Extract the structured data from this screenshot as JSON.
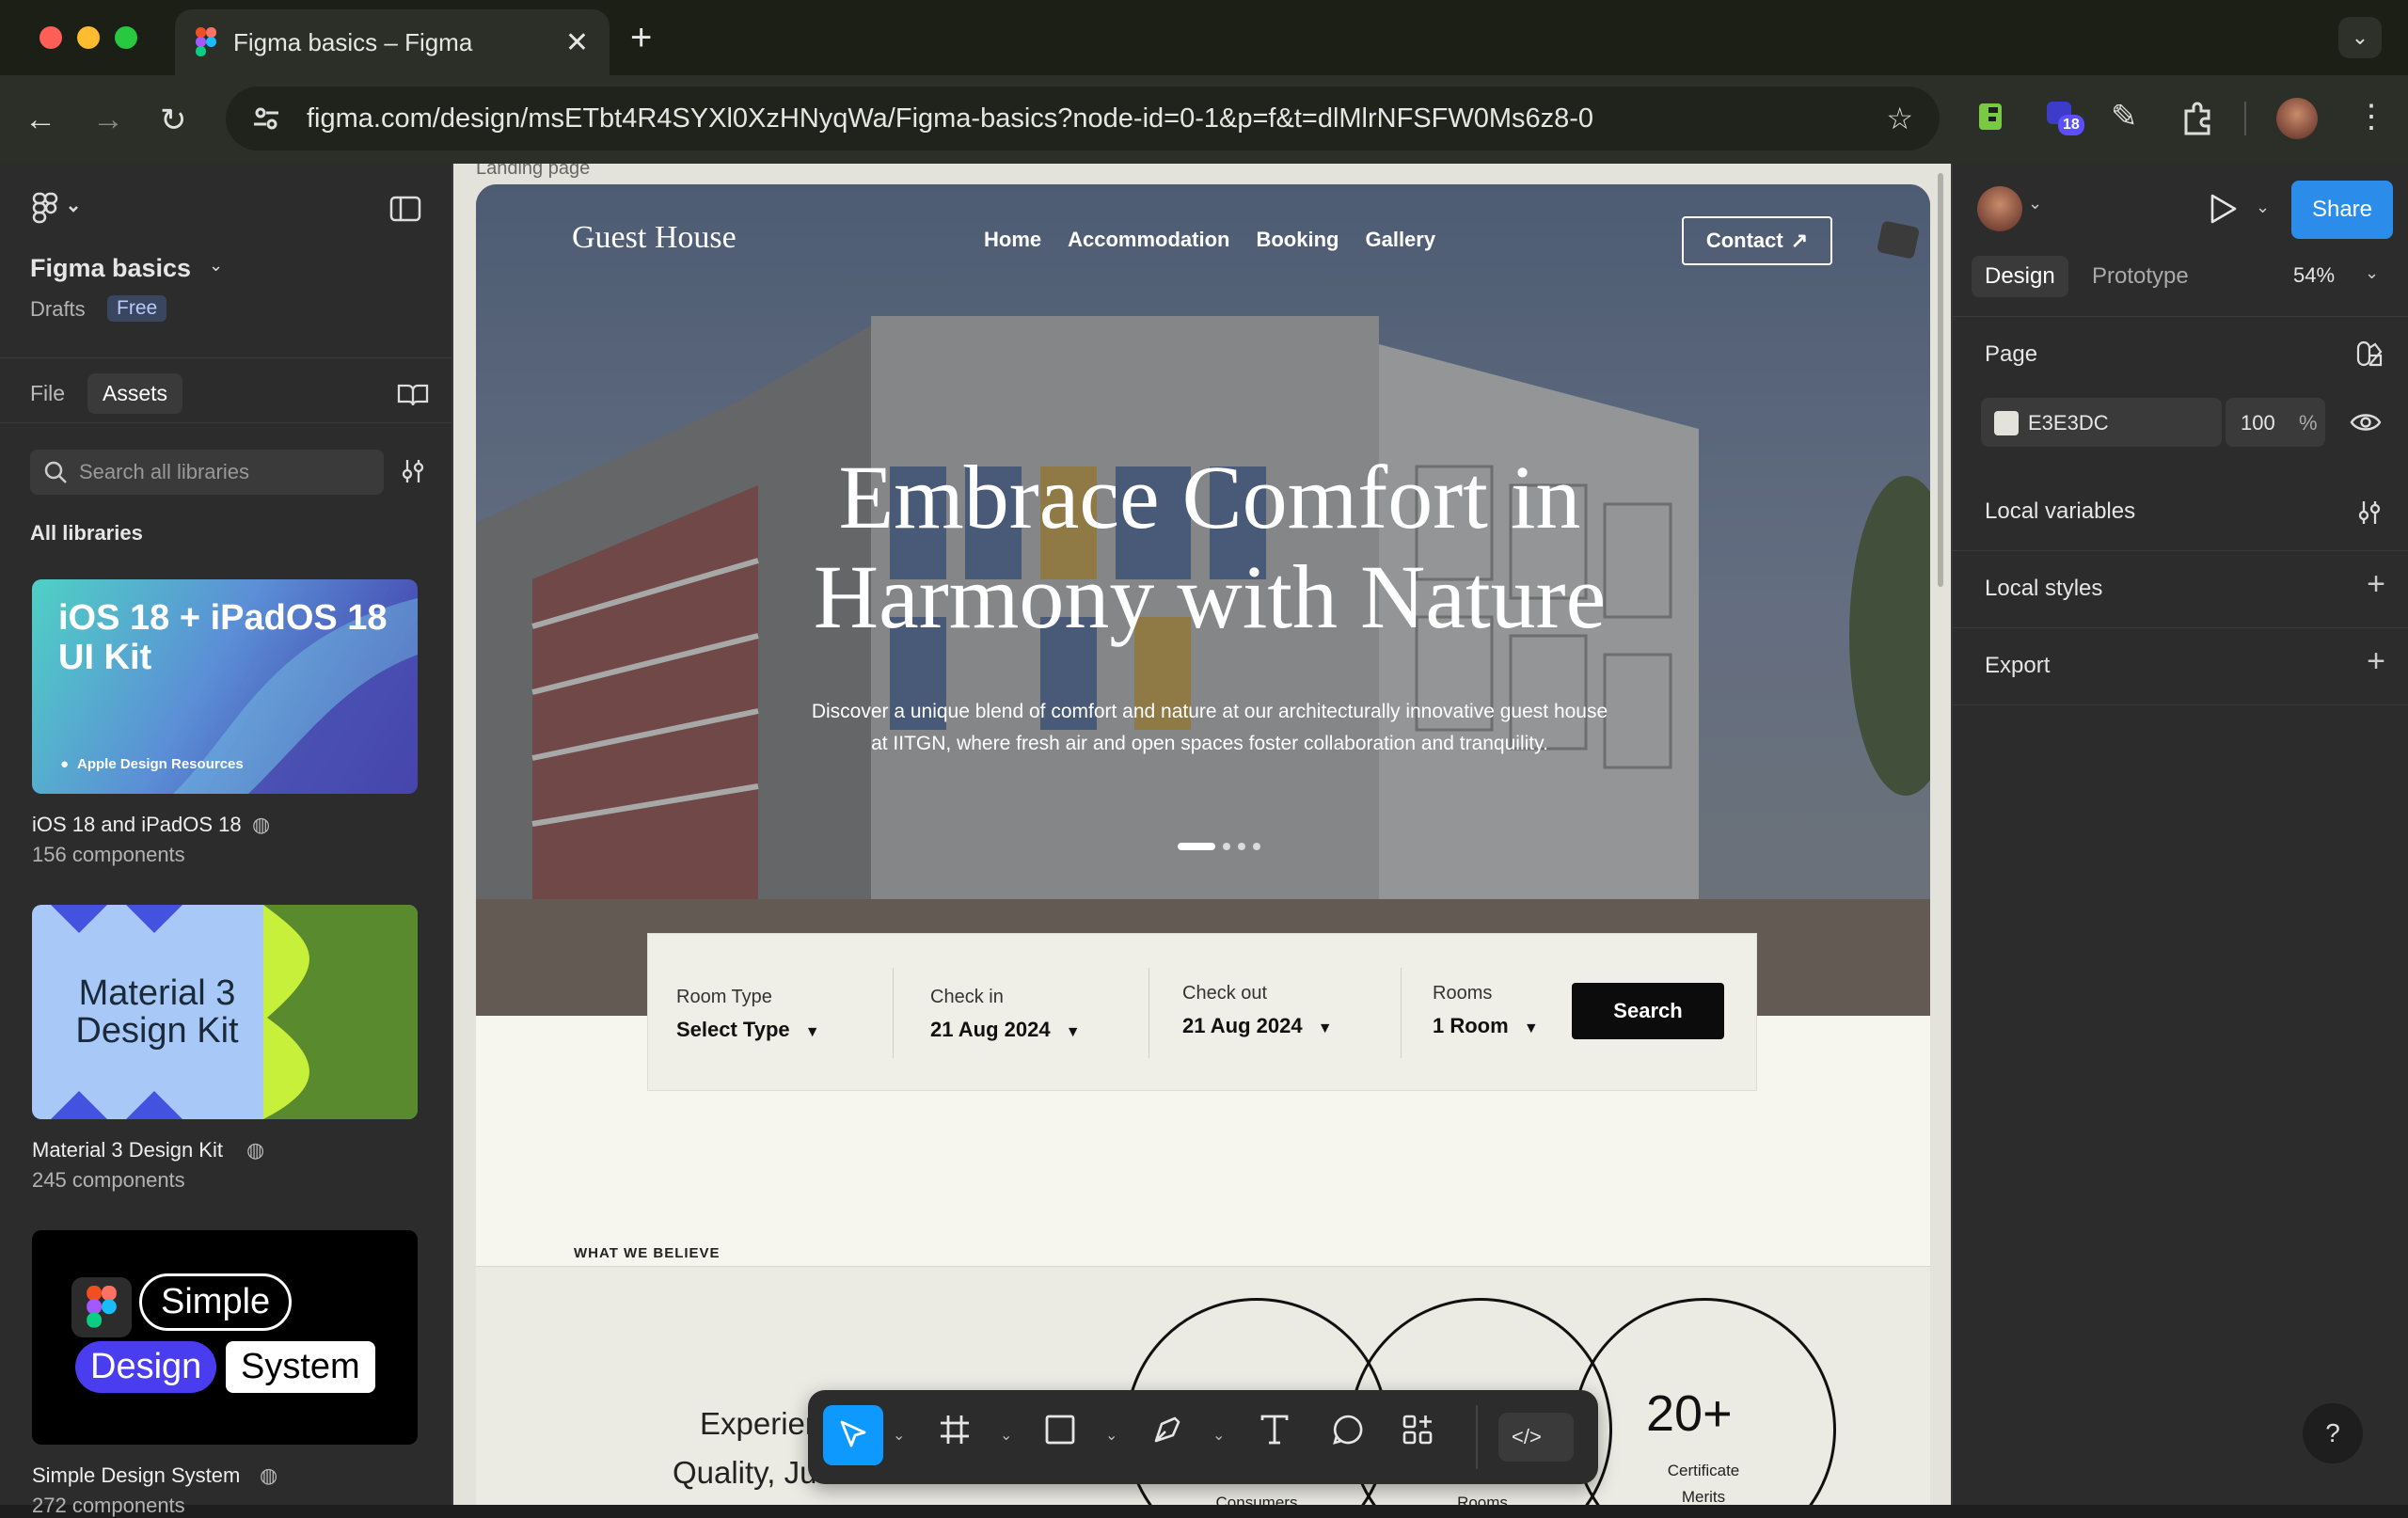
{
  "browser": {
    "tab_title": "Figma basics – Figma",
    "url": "figma.com/design/msETbt4R4SYXl0XzHNyqWa/Figma-basics?node-id=0-1&p=f&t=dlMlrNFSFW0Ms6z8-0",
    "extension_badge": "18"
  },
  "left_panel": {
    "project_name": "Figma basics",
    "location": "Drafts",
    "plan_badge": "Free",
    "tabs": [
      "File",
      "Assets"
    ],
    "search_placeholder": "Search all libraries",
    "section_title": "All libraries",
    "libraries": [
      {
        "name": "iOS 18 and iPadOS 18",
        "count": "156 components",
        "thumb_title": "iOS 18 + iPadOS 18 UI Kit",
        "thumb_caption": "Apple Design Resources"
      },
      {
        "name": "Material 3 Design Kit",
        "count": "245 components",
        "thumb_title": "Material 3 Design Kit"
      },
      {
        "name": "Simple Design System",
        "count": "272 components",
        "thumb_words": [
          "Simple",
          "Design",
          "System"
        ]
      }
    ]
  },
  "canvas": {
    "frame_label": "Landing page",
    "site": {
      "logo": "Guest House",
      "nav": [
        "Home",
        "Accommodation",
        "Booking",
        "Gallery"
      ],
      "contact": "Contact",
      "headline_line1": "Embrace Comfort in",
      "headline_line2": "Harmony with Nature",
      "subtitle": "Discover a unique blend of comfort and nature at our architecturally innovative guest house at IITGN, where fresh air and open spaces foster collaboration and tranquility.",
      "booking": {
        "fields": [
          {
            "label": "Room Type",
            "value": "Select Type"
          },
          {
            "label": "Check in",
            "value": "21 Aug 2024"
          },
          {
            "label": "Check out",
            "value": "21 Aug 2024"
          },
          {
            "label": "Rooms",
            "value": "1 Room"
          }
        ],
        "search": "Search"
      },
      "section_kicker": "WHAT WE BELIEVE",
      "experience_line1": "Experience Unm",
      "experience_line2": "Quality, Just For You",
      "stats": [
        {
          "number": "",
          "label": "Consumers"
        },
        {
          "number": "",
          "label": "Rooms"
        },
        {
          "number": "20+",
          "label": "Certificate Merits"
        }
      ]
    }
  },
  "right_panel": {
    "share": "Share",
    "tabs": [
      "Design",
      "Prototype"
    ],
    "zoom": "54%",
    "page_section": "Page",
    "page_color": "E3E3DC",
    "page_opacity": "100",
    "opacity_unit": "%",
    "sections": [
      "Local variables",
      "Local styles",
      "Export"
    ]
  },
  "colors": {
    "accent": "#0d99ff",
    "share_blue": "#2b8de9",
    "page_bg": "#e3e3dc"
  }
}
